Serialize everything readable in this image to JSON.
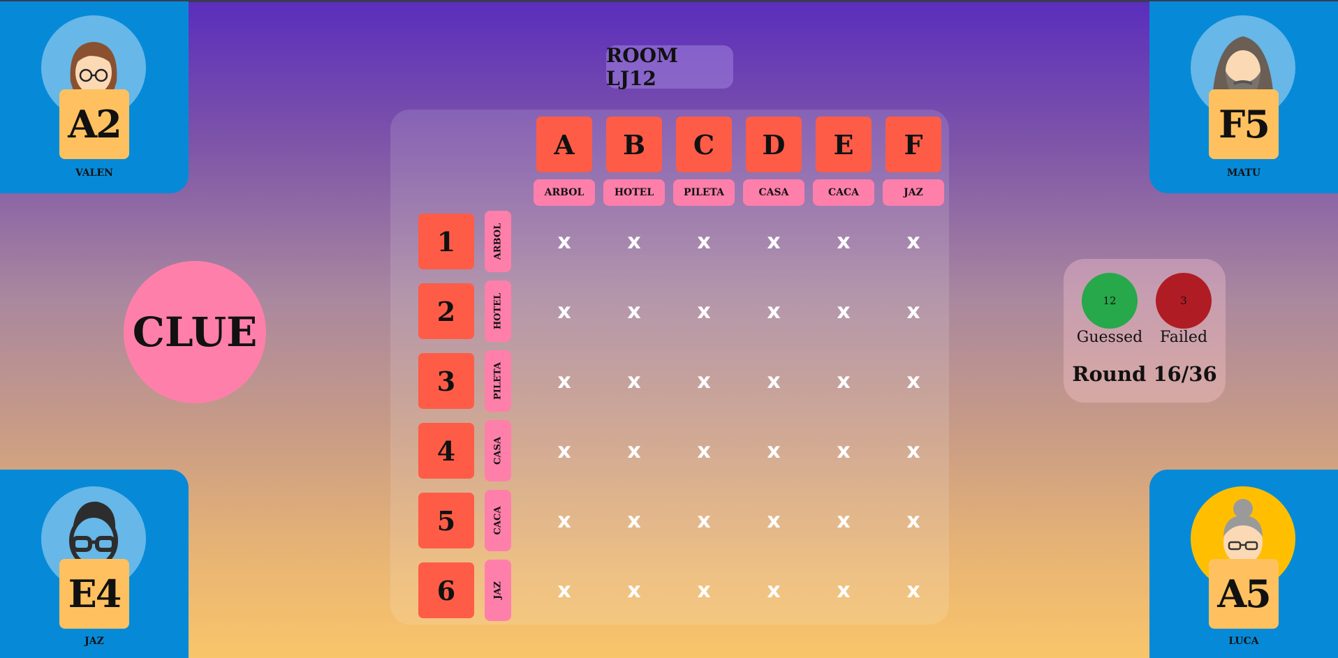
{
  "room": {
    "label": "ROOM LJ12"
  },
  "clue_button": {
    "label": "CLUE"
  },
  "players": [
    {
      "name": "VALEN",
      "card": "A2",
      "avatar": "woman-glasses-icon"
    },
    {
      "name": "MATU",
      "card": "F5",
      "avatar": "bearded-man-hood-icon"
    },
    {
      "name": "JAZ",
      "card": "E4",
      "avatar": "man-glasses-icon"
    },
    {
      "name": "LUCA",
      "card": "A5",
      "avatar": "grandma-glasses-icon"
    }
  ],
  "board": {
    "columns": [
      {
        "letter": "A",
        "word": "ARBOL"
      },
      {
        "letter": "B",
        "word": "HOTEL"
      },
      {
        "letter": "C",
        "word": "PILETA"
      },
      {
        "letter": "D",
        "word": "CASA"
      },
      {
        "letter": "E",
        "word": "CACA"
      },
      {
        "letter": "F",
        "word": "JAZ"
      }
    ],
    "rows": [
      {
        "number": "1",
        "word": "ARBOL"
      },
      {
        "number": "2",
        "word": "HOTEL"
      },
      {
        "number": "3",
        "word": "PILETA"
      },
      {
        "number": "4",
        "word": "CASA"
      },
      {
        "number": "5",
        "word": "CACA"
      },
      {
        "number": "6",
        "word": "JAZ"
      }
    ],
    "cell_mark": "x"
  },
  "score": {
    "guessed_value": "12",
    "guessed_label": "Guessed",
    "failed_value": "3",
    "failed_label": "Failed",
    "round": "Round 16/36"
  },
  "colors": {
    "accent_red": "#ff5c47",
    "accent_pink": "#ff7fab",
    "card": "#ffc160",
    "corner": "#068ad8",
    "guessed": "#27a84a",
    "failed": "#b01c24"
  }
}
